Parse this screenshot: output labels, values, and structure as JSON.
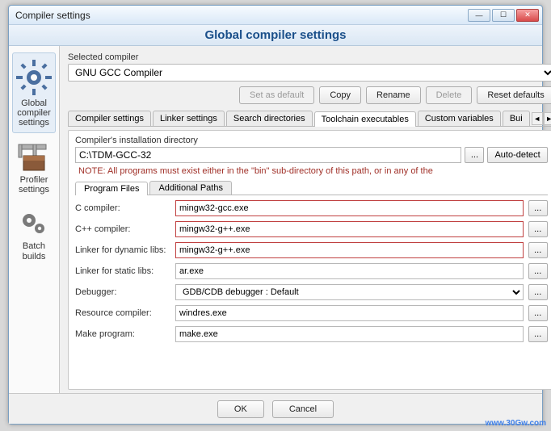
{
  "window": {
    "title": "Compiler settings",
    "banner": "Global compiler settings"
  },
  "sidebar": {
    "items": [
      {
        "label": "Global compiler settings"
      },
      {
        "label": "Profiler settings"
      },
      {
        "label": "Batch builds"
      }
    ]
  },
  "selected_compiler": {
    "label": "Selected compiler",
    "value": "GNU GCC Compiler"
  },
  "actions": {
    "set_default": "Set as default",
    "copy": "Copy",
    "rename": "Rename",
    "delete": "Delete",
    "reset": "Reset defaults"
  },
  "tabs": [
    "Compiler settings",
    "Linker settings",
    "Search directories",
    "Toolchain executables",
    "Custom variables",
    "Bui"
  ],
  "install": {
    "label": "Compiler's installation directory",
    "path": "C:\\TDM-GCC-32",
    "browse": "...",
    "autodetect": "Auto-detect",
    "note": "NOTE: All programs must exist either in the \"bin\" sub-directory of this path, or in any of the"
  },
  "subtabs": [
    "Program Files",
    "Additional Paths"
  ],
  "programs": {
    "c": {
      "label": "C compiler:",
      "value": "mingw32-gcc.exe"
    },
    "cpp": {
      "label": "C++ compiler:",
      "value": "mingw32-g++.exe"
    },
    "linker_dyn": {
      "label": "Linker for dynamic libs:",
      "value": "mingw32-g++.exe"
    },
    "linker_static": {
      "label": "Linker for static libs:",
      "value": "ar.exe"
    },
    "debugger": {
      "label": "Debugger:",
      "value": "GDB/CDB debugger : Default"
    },
    "rc": {
      "label": "Resource compiler:",
      "value": "windres.exe"
    },
    "make": {
      "label": "Make program:",
      "value": "make.exe"
    }
  },
  "footer": {
    "ok": "OK",
    "cancel": "Cancel"
  },
  "watermark": "www.30Gw.com"
}
